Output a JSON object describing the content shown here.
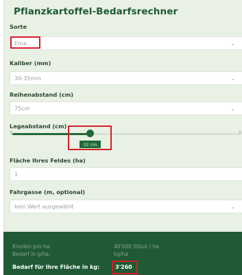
{
  "title": "Pflanzkartoffel-Bedarfsrechner",
  "fields": {
    "sorte": {
      "label": "Sorte",
      "value": "Ema"
    },
    "kaliber": {
      "label": "Kaliber (mm)",
      "value": "30-35mm"
    },
    "reihenabstand": {
      "label": "Reihenabstand (cm)",
      "value": "75cm"
    },
    "legeabstand": {
      "label": "Legeabstand (cm)",
      "value_label": "32 cm",
      "min_label": "5",
      "max_label": "5",
      "fraction": 0.34
    },
    "flaeche": {
      "label": "Fläche Ihres Feldes (ha)",
      "value": "1"
    },
    "fahrgasse": {
      "label": "Fahrgasse (m, optional)",
      "value": "kein Wert ausgewählt"
    }
  },
  "results": {
    "row1_label": "Knollen pro ha:",
    "row1_value": "40'000 Stück / ha",
    "row2_label": "Bedarf in g/ha:",
    "row2_value": "kg/ha",
    "total_label": "Bedarf für Ihre Fläche in kg:",
    "total_value": "3'260"
  },
  "colors": {
    "brand": "#1f5a34",
    "accent": "#1f6a39",
    "highlight": "#d21f2a"
  }
}
